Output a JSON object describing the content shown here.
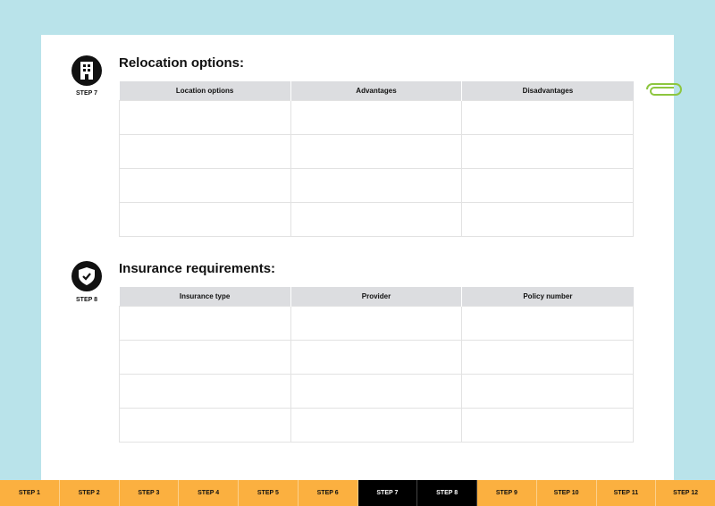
{
  "sections": [
    {
      "step": "STEP 7",
      "title": "Relocation options:",
      "icon": "building-icon",
      "columns": [
        "Location options",
        "Advantages",
        "Disadvantages"
      ],
      "rows": 4
    },
    {
      "step": "STEP 8",
      "title": "Insurance requirements:",
      "icon": "shield-check-icon",
      "columns": [
        "Insurance type",
        "Provider",
        "Policy number"
      ],
      "rows": 4
    }
  ],
  "tabs": [
    "STEP 1",
    "STEP 2",
    "STEP 3",
    "STEP 4",
    "STEP 5",
    "STEP 6",
    "STEP 7",
    "STEP 8",
    "STEP 9",
    "STEP 10",
    "STEP 11",
    "STEP 12"
  ],
  "active_tabs": [
    "STEP 7",
    "STEP 8"
  ],
  "colors": {
    "background": "#b9e3ea",
    "tab": "#fbb040",
    "active_tab": "#000000",
    "clip": "#8dc63f"
  }
}
